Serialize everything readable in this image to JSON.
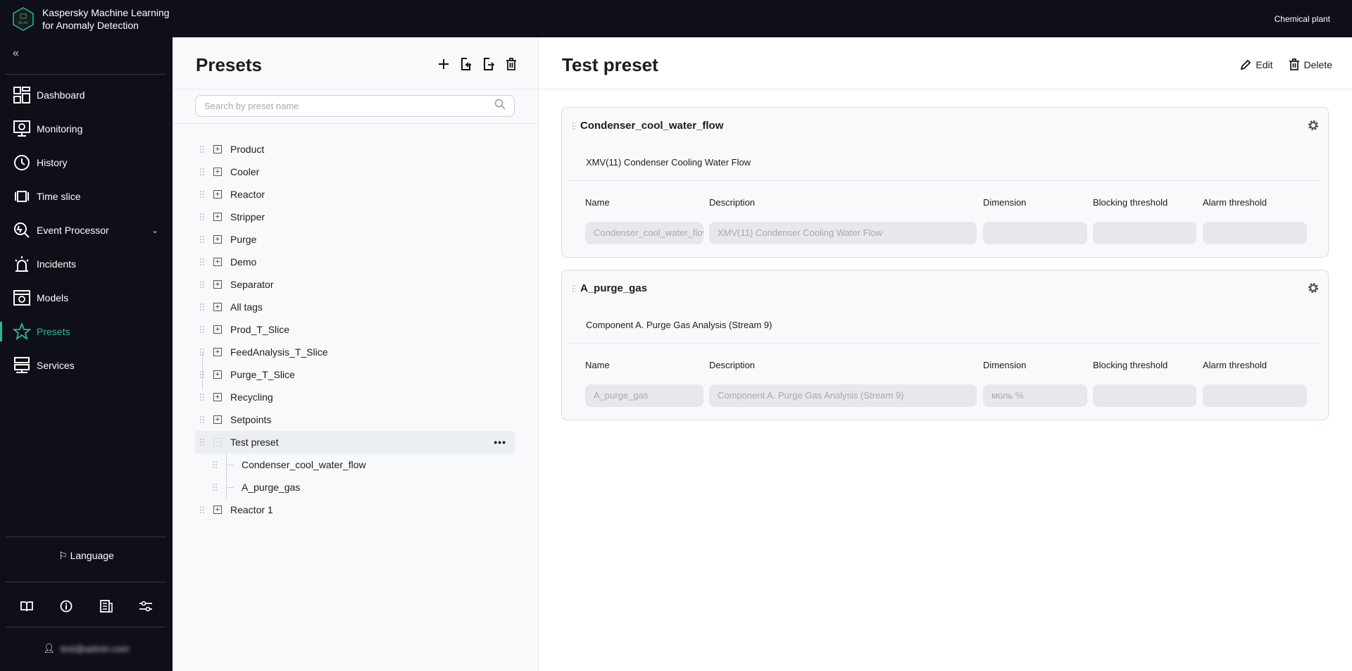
{
  "app": {
    "title_line1": "Kaspersky Machine Learning",
    "title_line2": "for Anomaly Detection",
    "logo_text": "MLAD",
    "site": "Chemical plant"
  },
  "sidebar": {
    "collapse": "«",
    "items": [
      {
        "label": "Dashboard",
        "icon": "dashboard-icon"
      },
      {
        "label": "Monitoring",
        "icon": "monitor-icon"
      },
      {
        "label": "History",
        "icon": "clock-icon"
      },
      {
        "label": "Time slice",
        "icon": "time-slice-icon"
      },
      {
        "label": "Event Processor",
        "icon": "event-processor-icon",
        "has_submenu": true
      },
      {
        "label": "Incidents",
        "icon": "alarm-icon"
      },
      {
        "label": "Models",
        "icon": "models-icon"
      },
      {
        "label": "Presets",
        "icon": "star-icon",
        "active": true
      },
      {
        "label": "Services",
        "icon": "server-icon"
      }
    ],
    "language": "Language",
    "user": "test@admin.com"
  },
  "presets": {
    "title": "Presets",
    "search_placeholder": "Search by preset name",
    "tree": [
      "Product",
      "Cooler",
      "Reactor",
      "Stripper",
      "Purge",
      "Demo",
      "Separator",
      "All tags",
      "Prod_T_Slice",
      "FeedAnalysis_T_Slice",
      "Purge_T_Slice",
      "Recycling",
      "Setpoints"
    ],
    "selected": {
      "label": "Test preset",
      "children": [
        "Condenser_cool_water_flow",
        "A_purge_gas"
      ]
    },
    "after": [
      "Reactor 1"
    ]
  },
  "main": {
    "title": "Test preset",
    "edit": "Edit",
    "delete": "Delete",
    "columns": [
      "Name",
      "Description",
      "Dimension",
      "Blocking threshold",
      "Alarm threshold"
    ],
    "cards": [
      {
        "title": "Condenser_cool_water_flow",
        "description": "XMV(11) Condenser Cooling Water Flow",
        "values": [
          "Condenser_cool_water_flow",
          "XMV(11) Condenser Cooling Water Flow",
          "",
          "",
          ""
        ]
      },
      {
        "title": "A_purge_gas",
        "description": "Component A. Purge Gas Analysis (Stream 9)",
        "values": [
          "A_purge_gas",
          "Component A. Purge Gas Analysis (Stream 9)",
          "моль %",
          "",
          ""
        ]
      }
    ]
  },
  "colors": {
    "accent": "#2fb59a",
    "dark": "#0e0f18"
  }
}
